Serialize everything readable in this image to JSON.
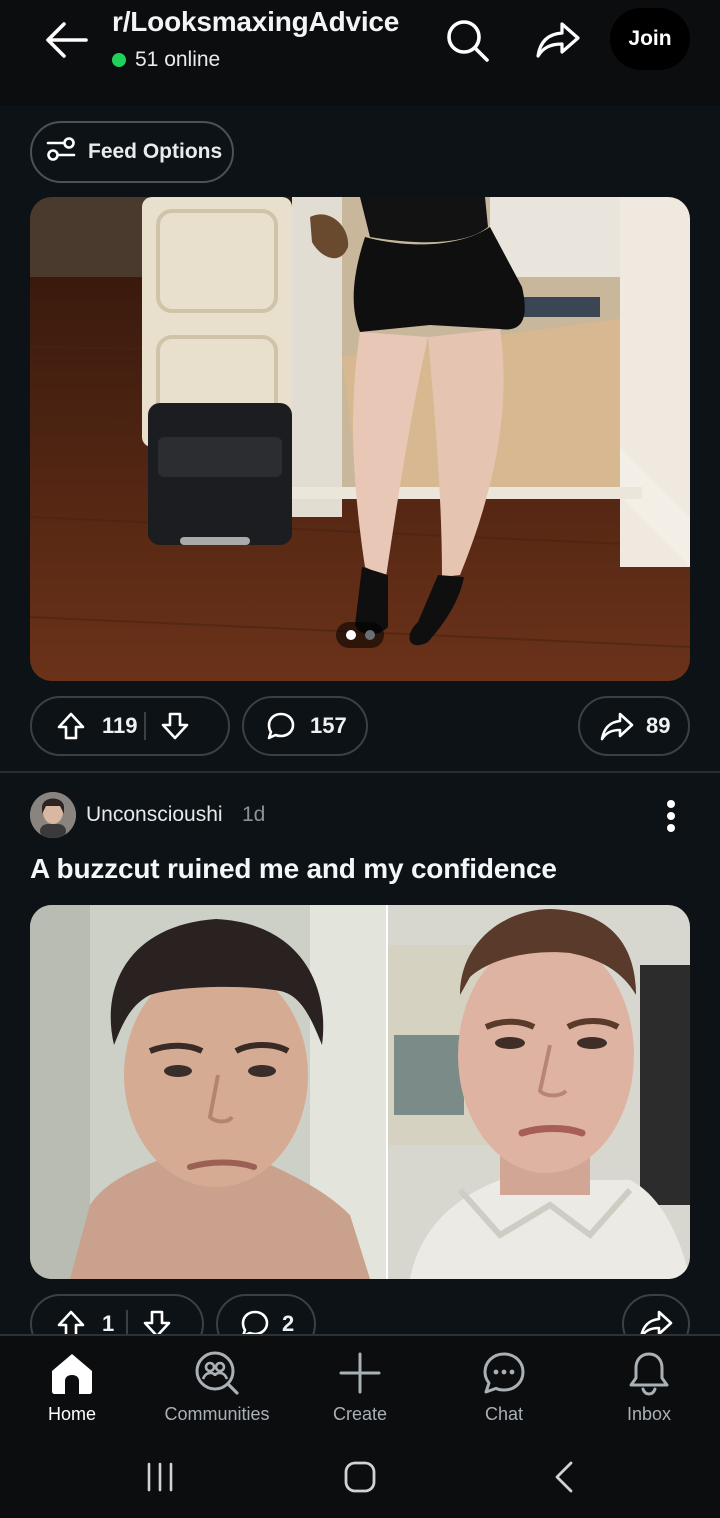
{
  "header": {
    "subreddit": "r/LooksmaxingAdvice",
    "online": "51 online",
    "join_label": "Join"
  },
  "feed_options": {
    "label": "Feed Options"
  },
  "post1": {
    "upvotes": "119",
    "comments": "157",
    "shares": "89",
    "carousel_position": 1,
    "carousel_total": 2
  },
  "post2": {
    "author": "Unconscioushi",
    "time": "1d",
    "title": "A buzzcut ruined me and my confidence",
    "upvotes": "1",
    "comments": "2"
  },
  "nav": {
    "items": [
      {
        "label": "Home",
        "icon": "home-icon"
      },
      {
        "label": "Communities",
        "icon": "communities-icon"
      },
      {
        "label": "Create",
        "icon": "plus-icon"
      },
      {
        "label": "Chat",
        "icon": "chat-icon"
      },
      {
        "label": "Inbox",
        "icon": "bell-icon"
      }
    ]
  },
  "colors": {
    "background": "#0d1216",
    "online_dot": "#1fd15a",
    "pill_border": "#3a4146"
  }
}
